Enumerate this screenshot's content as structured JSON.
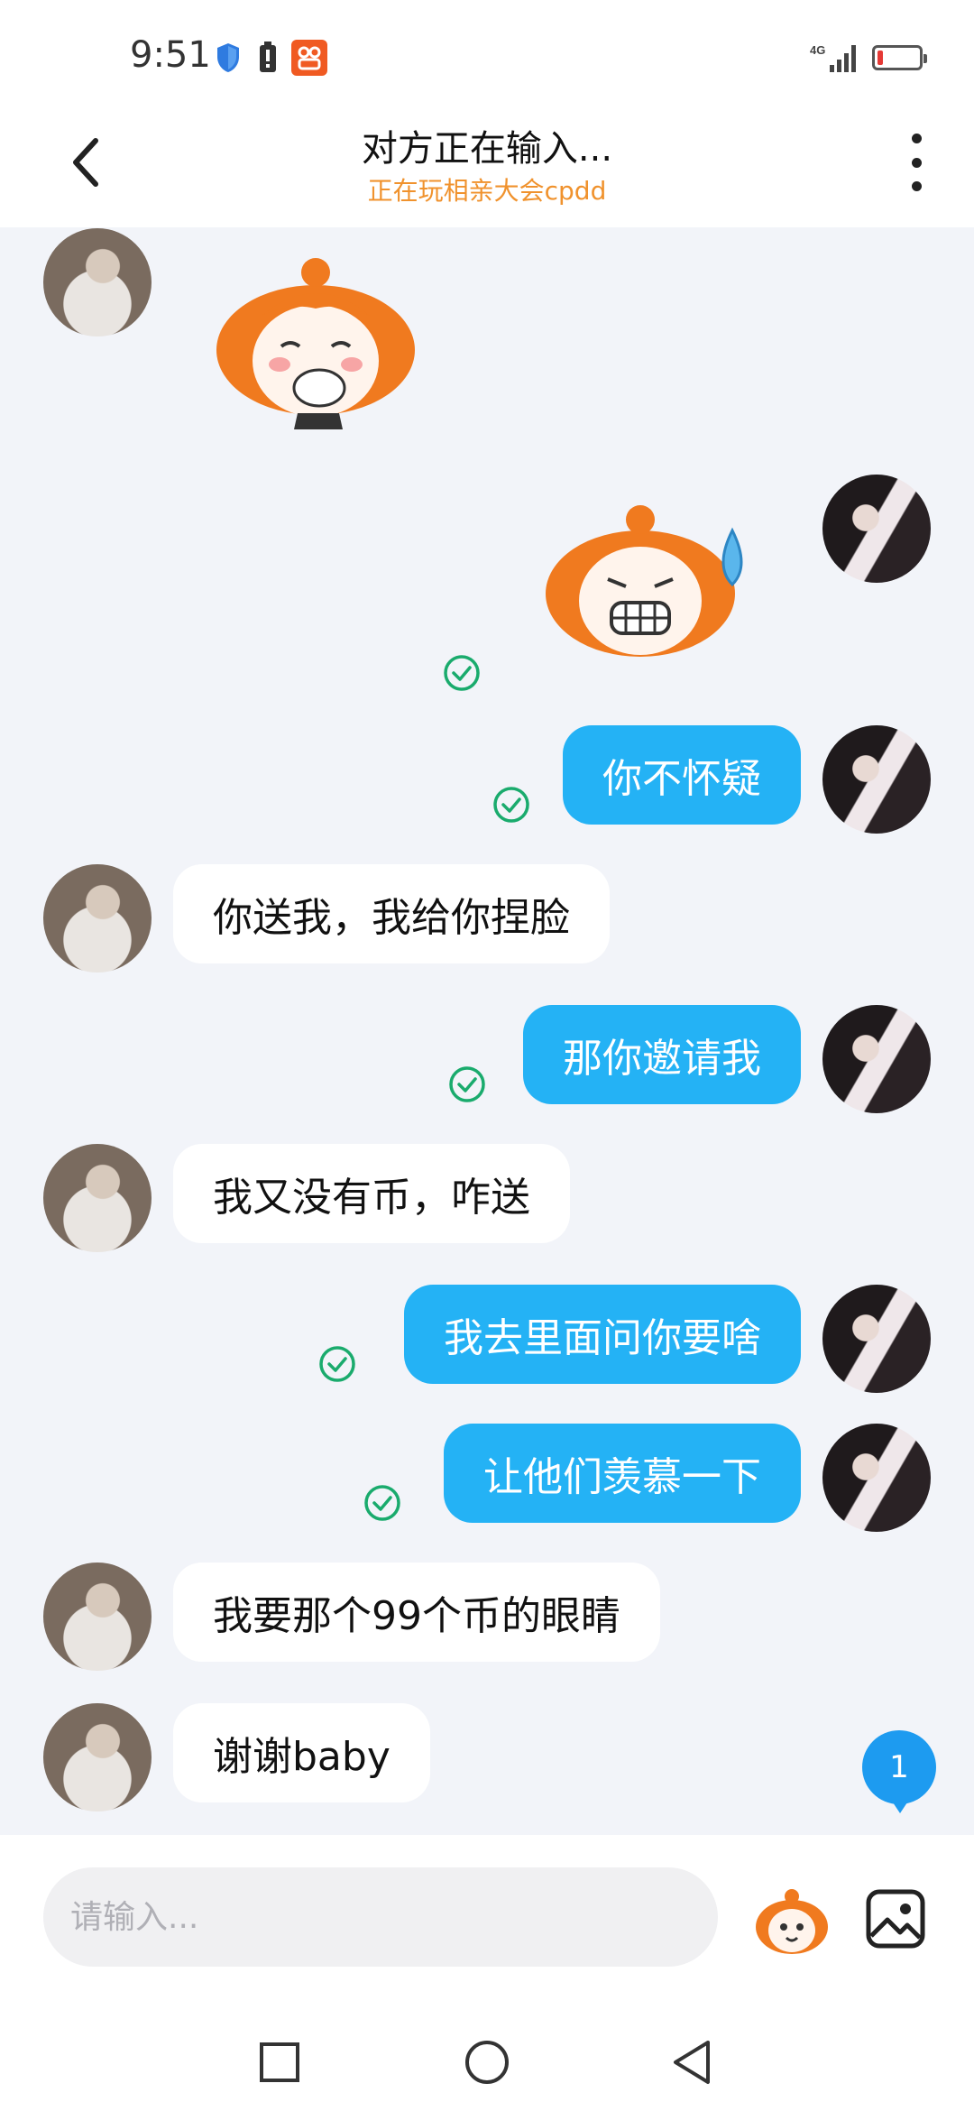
{
  "status_bar": {
    "time": "9:51",
    "network": "4G",
    "icons": [
      "shield-icon",
      "battery-alert-icon",
      "app-notification-icon",
      "signal-icon",
      "battery-icon"
    ]
  },
  "header": {
    "title": "对方正在输入...",
    "subtitle": "正在玩相亲大会cpdd",
    "back_icon": "chevron-left-icon",
    "more_icon": "more-vertical-icon"
  },
  "messages": [
    {
      "from": "other",
      "type": "sticker",
      "sticker": "orange-hair-girl-covering-mouth"
    },
    {
      "from": "me",
      "type": "sticker",
      "sticker": "orange-hair-girl-sweating-grimace",
      "read": true
    },
    {
      "from": "me",
      "type": "text",
      "text": "你不怀疑",
      "read": true
    },
    {
      "from": "other",
      "type": "text",
      "text": "你送我，我给你捏脸"
    },
    {
      "from": "me",
      "type": "text",
      "text": "那你邀请我",
      "read": true
    },
    {
      "from": "other",
      "type": "text",
      "text": "我又没有币，咋送"
    },
    {
      "from": "me",
      "type": "text",
      "text": "我去里面问你要啥",
      "read": true
    },
    {
      "from": "me",
      "type": "text",
      "text": "让他们羡慕一下",
      "read": true
    },
    {
      "from": "other",
      "type": "text",
      "text": "我要那个99个币的眼睛"
    },
    {
      "from": "other",
      "type": "text",
      "text": "谢谢baby"
    }
  ],
  "unread_badge": "1",
  "input": {
    "placeholder": "请输入...",
    "value": "",
    "emoji_icon": "mascot-emoji-icon",
    "image_icon": "image-icon"
  },
  "nav_bar": [
    "recents-square-icon",
    "home-circle-icon",
    "back-triangle-icon"
  ],
  "colors": {
    "accent": "#24b2f5",
    "subtitle": "#f0922d",
    "read_check": "#1aab6d",
    "background": "#f2f4f9"
  }
}
